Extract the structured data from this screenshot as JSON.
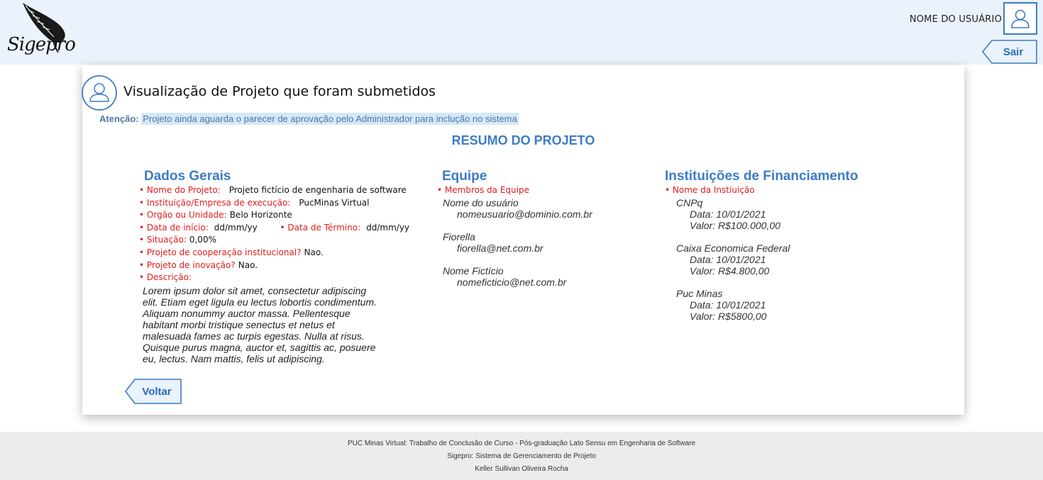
{
  "header": {
    "logo_text": "Sigepro",
    "username": "NOME DO USUÁRIO",
    "logout_label": "Sair"
  },
  "page": {
    "title": "Visualização de Projeto que foram submetidos",
    "attention_label": "Atenção:",
    "attention_text": "Projeto ainda aguarda o parecer de aprovação pelo Administrador para inclução no sistema",
    "summary_heading": "RESUMO DO PROJETO"
  },
  "general": {
    "heading": "Dados Gerais",
    "project_name_label": "Nome do Projeto:",
    "project_name": "Projeto fictício de engenharia de software",
    "institution_label": "Instituição/Empresa de execução:",
    "institution": "PucMinas Virtual",
    "organ_label": "Orgão ou Unidade:",
    "organ": "Belo Horizonte",
    "start_label": "Data de início:",
    "start": "dd/mm/yy",
    "end_label": "Data de Término:",
    "end": "dd/mm/yy",
    "status_label": "Situação:",
    "status": "0,00%",
    "cooperation_label": "Projeto de cooperação institucional?",
    "cooperation": "Nao.",
    "innovation_label": "Projeto de inovação?",
    "innovation": "Nao.",
    "description_label": "Descrição:",
    "description": "Lorem ipsum dolor sit amet, consectetur adipiscing elit. Etiam eget ligula eu lectus lobortis condimentum. Aliquam nonummy auctor massa. Pellentesque habitant morbi tristique senectus et netus et malesuada fames ac turpis egestas. Nulla at risus. Quisque purus magna, auctor et, sagittis ac, posuere eu, lectus. Nam mattis, felis ut adipiscing."
  },
  "team": {
    "heading": "Equipe",
    "members_label": "Membros da Equipe",
    "members": [
      {
        "name": "Nome do usuário",
        "email": "nomeusuario@dominio.com.br"
      },
      {
        "name": "Fiorella",
        "email": "fiorella@net.com.br"
      },
      {
        "name": "Nome Fictício",
        "email": "nomeficticio@net.com.br"
      }
    ]
  },
  "funding": {
    "heading": "Instituições de Financiamento",
    "name_label": "Nome da Instiuição",
    "institutions": [
      {
        "name": "CNPq",
        "date": "Data: 10/01/2021",
        "value": "Valor: R$100.000,00"
      },
      {
        "name": "Caixa Economica Federal",
        "date": "Data: 10/01/2021",
        "value": "Valor: R$4.800,00"
      },
      {
        "name": "Puc Minas",
        "date": "Data: 10/01/2021",
        "value": "Valor: R$5800,00"
      }
    ]
  },
  "actions": {
    "back_label": "Voltar"
  },
  "footer": {
    "line1": "PUC Minas Virtual: Trabalho de Conclusão de Curso - Pós-graduação Lato Sensu em Engenharia de Software",
    "line2": "Sigepro: Sistema de Gerenciamento de Projeto",
    "line3": "Keller Sullivan Oliveira Rocha"
  },
  "colors": {
    "accent": "#3d7cc7",
    "label_red": "#e01b1b",
    "header_bg": "#eaf2fb",
    "footer_bg": "#ececec"
  }
}
